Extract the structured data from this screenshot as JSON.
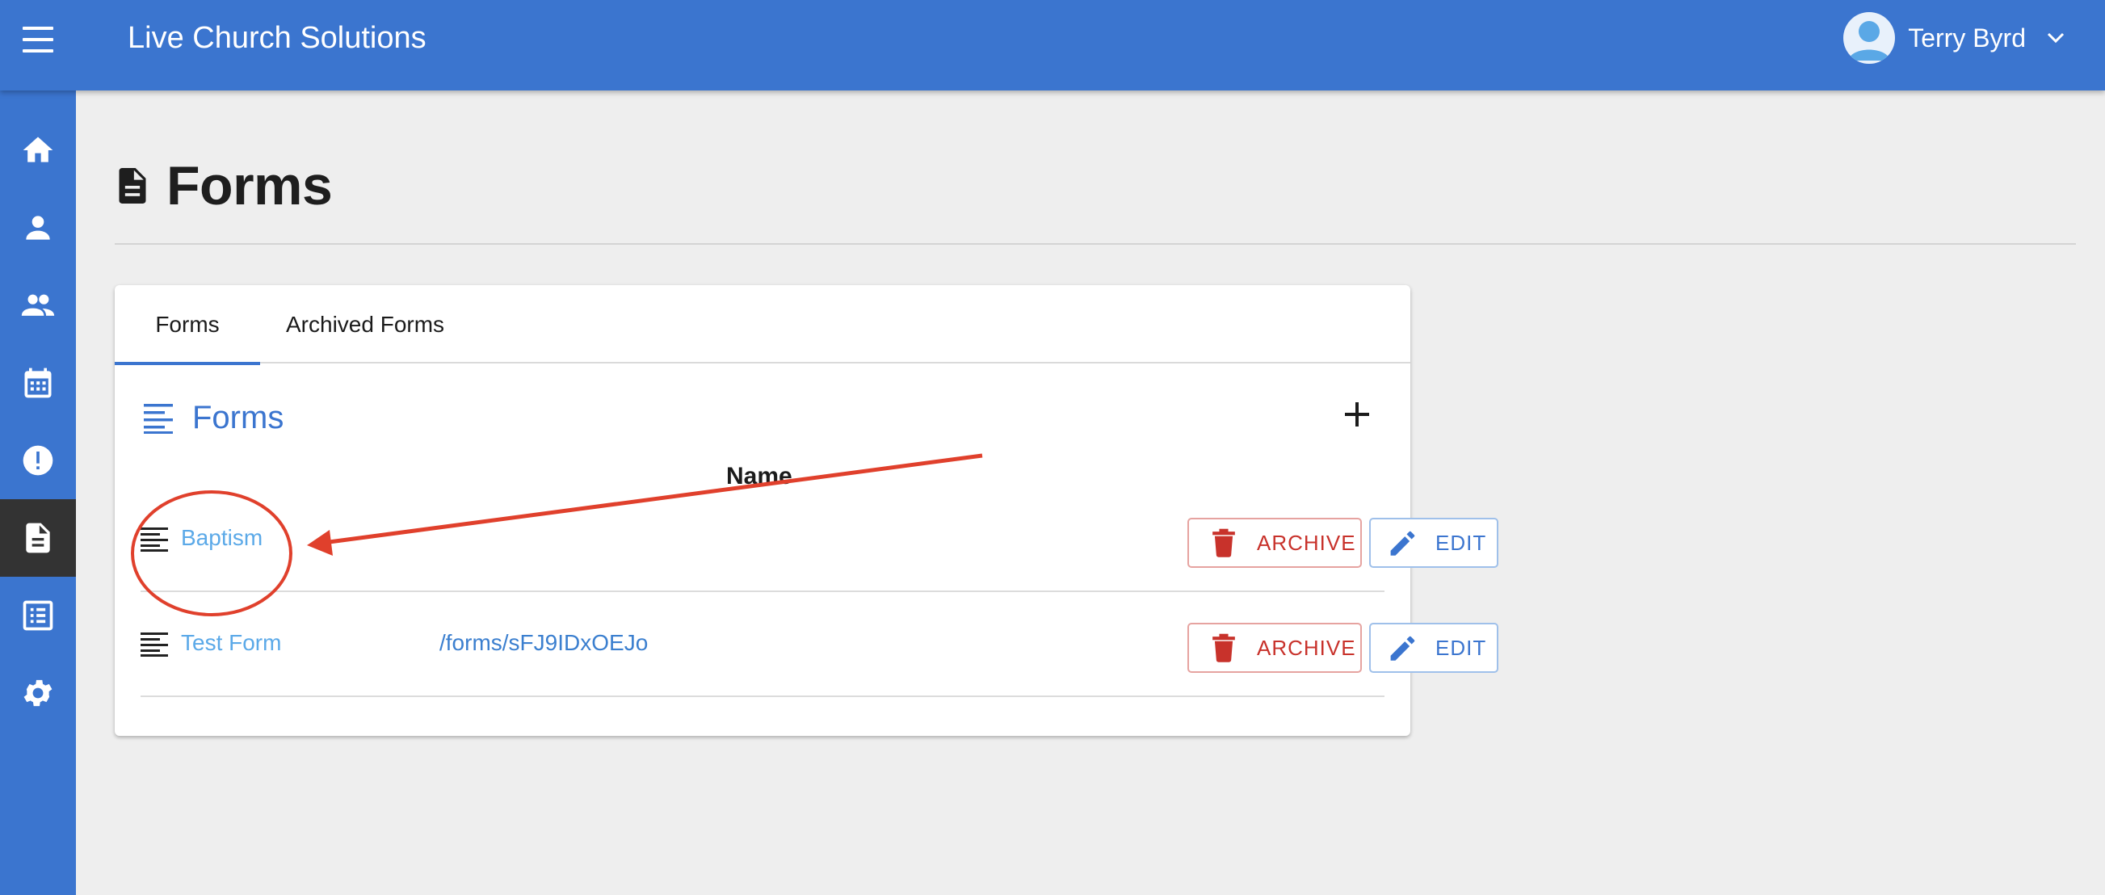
{
  "header": {
    "app_title": "Live Church Solutions",
    "user_name": "Terry Byrd"
  },
  "sidebar": {
    "items": [
      {
        "icon": "home-icon",
        "active": false
      },
      {
        "icon": "person-icon",
        "active": false
      },
      {
        "icon": "people-icon",
        "active": false
      },
      {
        "icon": "calendar-icon",
        "active": false
      },
      {
        "icon": "alert-icon",
        "active": false
      },
      {
        "icon": "document-icon",
        "active": true
      },
      {
        "icon": "list-alt-icon",
        "active": false
      },
      {
        "icon": "gear-icon",
        "active": false
      }
    ]
  },
  "page": {
    "title": "Forms"
  },
  "tabs": [
    {
      "label": "Forms",
      "active": true
    },
    {
      "label": "Archived Forms",
      "active": false
    }
  ],
  "section": {
    "title": "Forms",
    "column_header": "Name"
  },
  "rows": [
    {
      "name": "Baptism",
      "path": "",
      "archive_label": "ARCHIVE",
      "edit_label": "EDIT"
    },
    {
      "name": "Test Form",
      "path": "/forms/sFJ9IDxOEJo",
      "archive_label": "ARCHIVE",
      "edit_label": "EDIT"
    }
  ],
  "colors": {
    "primary": "#3b75cf",
    "sidebar_active": "#333333",
    "archive": "#c8322b",
    "link": "#5ba9e8",
    "annotation": "#e0402c"
  }
}
